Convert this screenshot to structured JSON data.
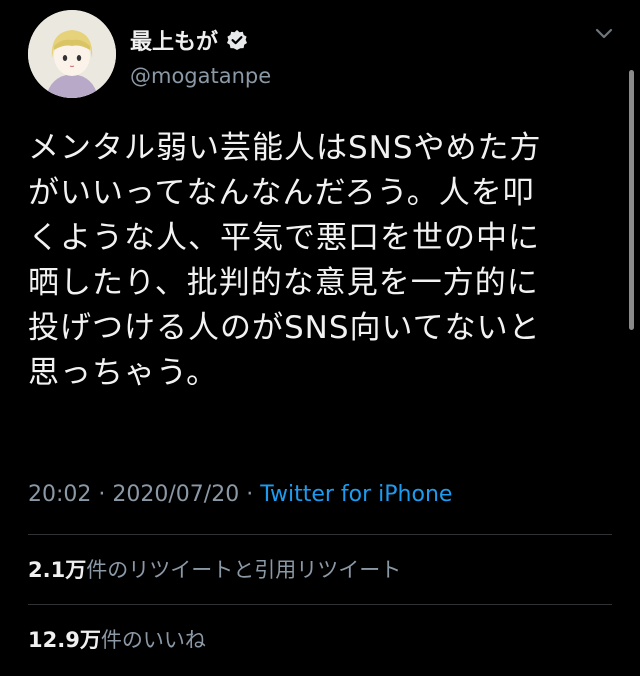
{
  "header": {
    "display_name": "最上もが",
    "handle": "@mogatanpe"
  },
  "tweet": {
    "lines": [
      "メンタル弱い芸能人はSNSやめた方",
      "がいいってなんなんだろう。人を叩",
      "くような人、平気で悪口を世の中に",
      "晒したり、批判的な意見を一方的に",
      "投げつける人のがSNS向いてないと",
      "思っちゃう。"
    ]
  },
  "meta": {
    "time": "20:02",
    "separator1": " · ",
    "date": "2020/07/20",
    "separator2": " · ",
    "source": "Twitter for iPhone"
  },
  "stats": {
    "retweets_count": "2.1万",
    "retweets_label": "件のリツイートと引用リツイート",
    "likes_count": "12.9万",
    "likes_label": "件のいいね"
  },
  "colors": {
    "background": "#000000",
    "link": "#1d9bf0",
    "muted": "#8b98a5"
  }
}
